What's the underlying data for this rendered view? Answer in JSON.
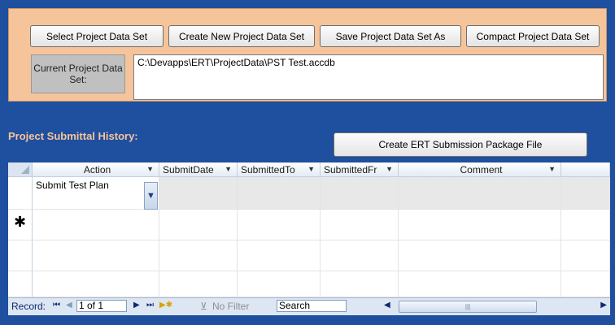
{
  "top": {
    "buttons": [
      "Select Project Data Set",
      "Create New Project Data Set",
      "Save Project Data Set As",
      "Compact Project Data Set"
    ],
    "current_label": "Current Project Data Set:",
    "current_value": "C:\\Devapps\\ERT\\ProjectData\\PST Test.accdb"
  },
  "history": {
    "title": "Project Submittal History:",
    "create_button": "Create ERT Submission Package File"
  },
  "grid": {
    "columns": [
      "Action",
      "SubmitDate",
      "SubmittedTo",
      "SubmittedFr",
      "Comment"
    ],
    "rows": [
      {
        "action": "Submit Test Plan",
        "submit_date": "",
        "submitted_to": "",
        "submitted_fr": "",
        "comment": ""
      }
    ],
    "new_row_marker": "✱"
  },
  "nav": {
    "record_label": "Record:",
    "position": "1 of 1",
    "filter_label": "No Filter",
    "search_label": "Search",
    "scroll_grip": "|||"
  }
}
